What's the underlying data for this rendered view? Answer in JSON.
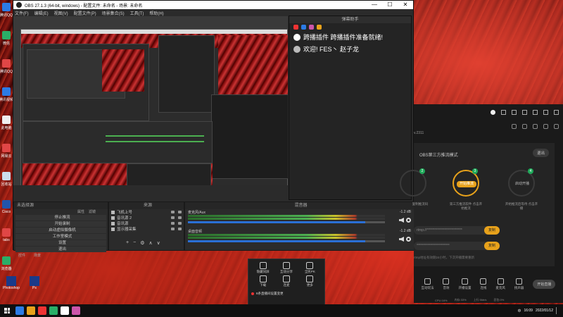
{
  "desktop": {
    "icons": [
      {
        "label": "腾讯QQ",
        "color": "#2c7be5"
      },
      {
        "label": "微信",
        "color": "#2aae67"
      },
      {
        "label": "腾讯QQ",
        "color": "#e04646"
      },
      {
        "label": "腾讯视频",
        "color": "#2c7be5"
      },
      {
        "label": "此电脑",
        "color": "#f0f0f0"
      },
      {
        "label": "网易云",
        "color": "#e04646"
      },
      {
        "label": "回收站",
        "color": "#cde"
      },
      {
        "label": "Cisco",
        "color": "#25a"
      },
      {
        "label": "tabs",
        "color": "#e04646"
      },
      {
        "label": "浏览器",
        "color": "#2aae67"
      }
    ],
    "bottom_icons": [
      {
        "label": "Photoshop",
        "color": "#1a3a8a"
      },
      {
        "label": "Ps",
        "color": "#1a3a8a"
      }
    ]
  },
  "obs": {
    "title": "OBS 27.1.3 (64-bit, windows) - 配置文件: 未命名 - 场景: 未命名",
    "window_controls": [
      "—",
      "☐",
      "✕"
    ],
    "menu": [
      "文件(F)",
      "编辑(E)",
      "视图(V)",
      "配置文件(P)",
      "场景集合(S)",
      "工具(T)",
      "帮助(H)"
    ],
    "scenes_panel": {
      "header": "未选择源",
      "properties_label": "属性",
      "filters_label": "滤镜",
      "controls_header": "控件",
      "controls": [
        "停止推流",
        "开始录制",
        "启动虚拟摄像机",
        "工作室模式",
        "设置",
        "退出"
      ],
      "tabs": [
        "控件",
        "场景"
      ]
    },
    "sources_panel": {
      "header": "来源",
      "items": [
        "飞机上号",
        "音讯源 2",
        "音讯源",
        "显示器采集"
      ]
    },
    "mixer_panel": {
      "header": "混音器",
      "tracks": [
        {
          "name": "麦克风/Aux",
          "db": "-1.2 dB"
        },
        {
          "name": "桌面音频",
          "db": "-1.2 dB"
        }
      ]
    }
  },
  "chat": {
    "title": "弹幕助手",
    "icon_colors": [
      "#e33",
      "#2c7be5",
      "#c5a",
      "#e8a21b"
    ],
    "lines": [
      {
        "text": "跨播插件 跨播插件准备就绪!"
      },
      {
        "text": "欢迎! FES丶 赵子龙"
      }
    ]
  },
  "stream_app": {
    "version_hint": "v.2311",
    "panel_title": "OBS第三方推流模式",
    "exit_label": "退出",
    "steps": [
      {
        "num": "2",
        "button": "",
        "desc": "复制推流码"
      },
      {
        "num": "3",
        "button": "开始推流",
        "desc": "第三方推流软件\n点击开始推流"
      },
      {
        "num": "4",
        "button": "启动开播",
        "desc": "开始推流后等待\n点击开播"
      }
    ],
    "inputs": [
      {
        "placeholder": "rtmp://**************************",
        "copy": "复制"
      },
      {
        "placeholder": "************************",
        "copy": "复制"
      }
    ],
    "hint": "rtmp地址有效期24小时，下次开播需要重新",
    "toolbar": [
      "互动玩法",
      "音效",
      "开播设置",
      "连线",
      "麦克风",
      "扬声器"
    ],
    "start_live": "开始直播",
    "status": [
      "CPU:16%",
      "内存:33%",
      "上行:0kb/s",
      "丢包:0%"
    ]
  },
  "tools_popup": {
    "tools": [
      "隐藏同屏",
      "互动分享",
      "全民PK",
      "下载",
      "连麦",
      "更多"
    ],
    "tip": "6条直播间设置变更"
  },
  "taskbar": {
    "app_colors": [
      "#2c7be5",
      "#e8a21b",
      "#e33",
      "#2aae67",
      "#fff",
      "#c5a"
    ],
    "tray_time": "16:09",
    "tray_date": "2022/01/12",
    "ime": "中"
  }
}
